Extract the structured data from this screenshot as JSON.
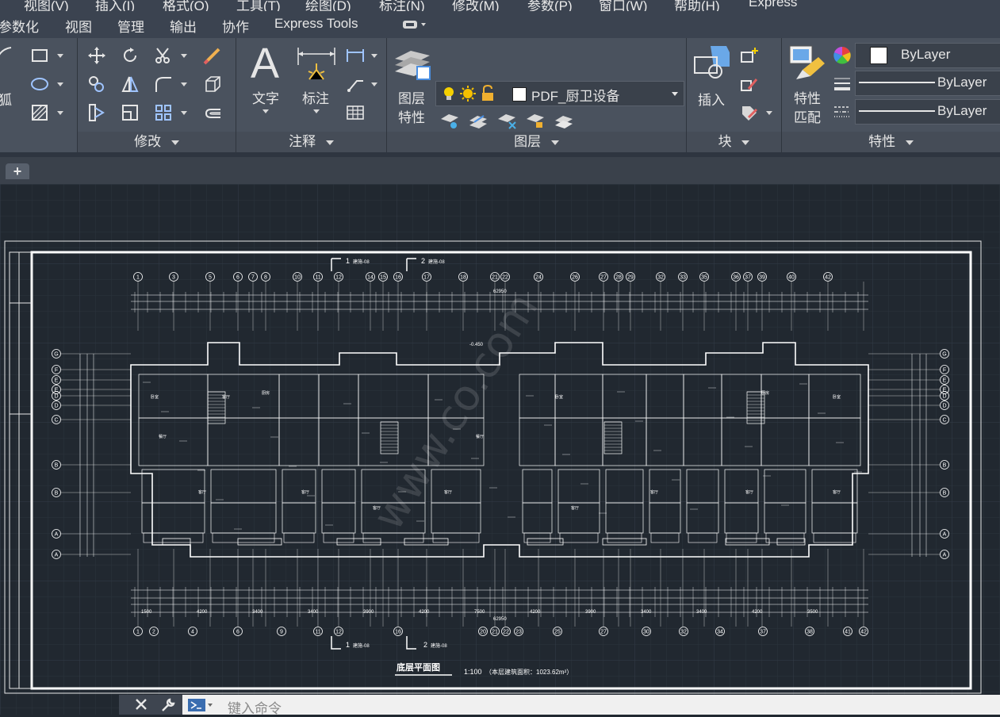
{
  "menu": {
    "items": [
      "视图(V)",
      "插入(I)",
      "格式(O)",
      "工具(T)",
      "绘图(D)",
      "标注(N)",
      "修改(M)",
      "参数(P)",
      "窗口(W)",
      "帮助(H)",
      "Express"
    ]
  },
  "ribbon_tabs": [
    "参数化",
    "视图",
    "管理",
    "输出",
    "协作",
    "Express Tools"
  ],
  "ribbon": {
    "draw_partial_label": "狐",
    "modify_title": "修改",
    "annotation": {
      "title": "注释",
      "text_label": "文字",
      "dim_label": "标注"
    },
    "layers": {
      "title": "图层",
      "props_label": [
        "图层",
        "特性"
      ],
      "current_layer": "PDF_厨卫设备"
    },
    "block": {
      "title": "块",
      "insert_label": "插入"
    },
    "properties": {
      "title": "特性",
      "match_label": [
        "特性",
        "匹配"
      ],
      "color": "ByLayer",
      "linetype": "ByLayer",
      "lineweight": "ByLayer"
    }
  },
  "drawing": {
    "title": "底层平面图",
    "scale": "1:100",
    "area_note": "（本层建筑面积：1023.62m²）",
    "section_1": "1",
    "section_2": "2",
    "section_ref": "建施-08",
    "total_dim": "62950",
    "elev_mark": "-0.450",
    "watermark": "www.co.com",
    "top_axes": [
      "1",
      "3",
      "5",
      "6",
      "7",
      "8",
      "10",
      "11",
      "12",
      "14",
      "15",
      "16",
      "17",
      "18",
      "21",
      "22",
      "24",
      "26",
      "27",
      "28",
      "29",
      "32",
      "33",
      "35",
      "36",
      "37",
      "39",
      "40",
      "42"
    ],
    "bottom_axes": [
      "1",
      "2",
      "4",
      "6",
      "9",
      "11",
      "12",
      "16",
      "20",
      "21",
      "22",
      "23",
      "25",
      "27",
      "30",
      "32",
      "34",
      "37",
      "38",
      "41",
      "42"
    ],
    "row_axes_left": [
      "G",
      "F",
      "E",
      "E",
      "D",
      "D",
      "C",
      "B",
      "B",
      "A",
      "A"
    ],
    "bottom_dims_a": [
      "1500",
      "4200",
      "3400",
      "3400",
      "3900",
      "4200",
      "7500",
      "4200",
      "3900",
      "3400",
      "3400",
      "4200",
      "3500"
    ],
    "room_tags": [
      "卧室",
      "客厅",
      "厨房",
      "卫生间",
      "餐厅",
      "阳台"
    ]
  },
  "filetab": {
    "add_label": "+"
  },
  "command": {
    "placeholder": "键入命令"
  },
  "colors": {
    "accent": "#ffffff",
    "menu_bg": "#3b4350",
    "ribbon_bg": "#4a525e",
    "canvas_bg": "#212830",
    "drawing_lines": "#ffffff",
    "color_swatch": "#ffffff"
  }
}
